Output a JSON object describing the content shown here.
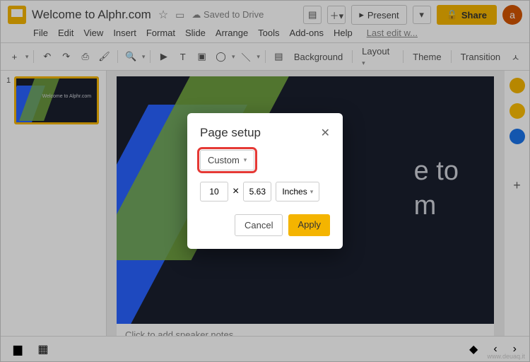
{
  "header": {
    "title": "Welcome to Alphr.com",
    "saved": "Saved to Drive",
    "present": "Present",
    "share": "Share",
    "avatar": "a"
  },
  "menus": [
    "File",
    "Edit",
    "View",
    "Insert",
    "Format",
    "Slide",
    "Arrange",
    "Tools",
    "Add-ons",
    "Help"
  ],
  "lastedit": "Last edit w...",
  "toolbar": {
    "background": "Background",
    "layout": "Layout",
    "theme": "Theme",
    "transition": "Transition"
  },
  "thumb": {
    "num": "1",
    "text": "Welcome to\nAlphr.com"
  },
  "slide": {
    "line1": "e to",
    "line2": "m"
  },
  "notes": "Click to add speaker notes",
  "dialog": {
    "title": "Page setup",
    "preset": "Custom",
    "width": "10",
    "height": "5.63",
    "unit": "Inches",
    "cancel": "Cancel",
    "apply": "Apply"
  },
  "watermark": "www.deuaq.it"
}
